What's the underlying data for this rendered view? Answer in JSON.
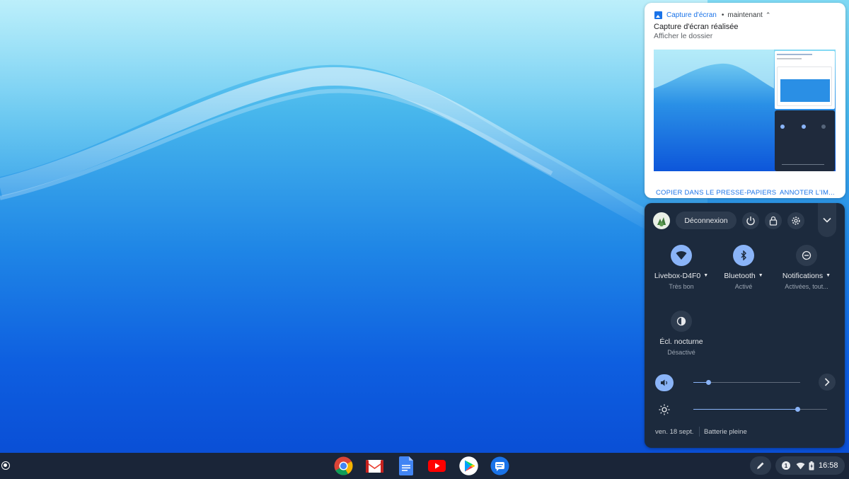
{
  "notification": {
    "app_name": "Capture d'écran",
    "time": "maintenant",
    "title": "Capture d'écran réalisée",
    "subtitle": "Afficher le dossier",
    "actions": [
      "COPIER DANS LE PRESSE-PAPIERS",
      "ANNOTER L'IM..."
    ],
    "app_icon": "image-icon"
  },
  "quick_settings": {
    "signout_label": "Déconnexion",
    "top_buttons": [
      "power-icon",
      "lock-icon",
      "gear-icon",
      "chevron-down-icon"
    ],
    "tiles": [
      {
        "label": "Livebox-D4F0",
        "sub": "Très bon",
        "icon": "wifi-icon",
        "active": true,
        "dropdown": true
      },
      {
        "label": "Bluetooth",
        "sub": "Activé",
        "icon": "bluetooth-icon",
        "active": true,
        "dropdown": true
      },
      {
        "label": "Notifications",
        "sub": "Activées, tout...",
        "icon": "do-not-disturb-icon",
        "active": false,
        "dropdown": true
      },
      {
        "label": "Écl. nocturne",
        "sub": "Désactivé",
        "icon": "night-light-icon",
        "active": false,
        "dropdown": false
      }
    ],
    "volume_level": 0.14,
    "brightness_level": 0.78,
    "date": "ven. 18 sept.",
    "battery": "Batterie pleine"
  },
  "shelf": {
    "apps": [
      "Chrome",
      "Gmail",
      "Docs",
      "YouTube",
      "Play Store",
      "Messages"
    ],
    "clock": "16:58",
    "notification_count": "1"
  },
  "colors": {
    "panel_bg": "#1c2a3d",
    "accent": "#8ab4f8",
    "link_blue": "#1a73e8",
    "shelf_bg": "#1a2538"
  }
}
